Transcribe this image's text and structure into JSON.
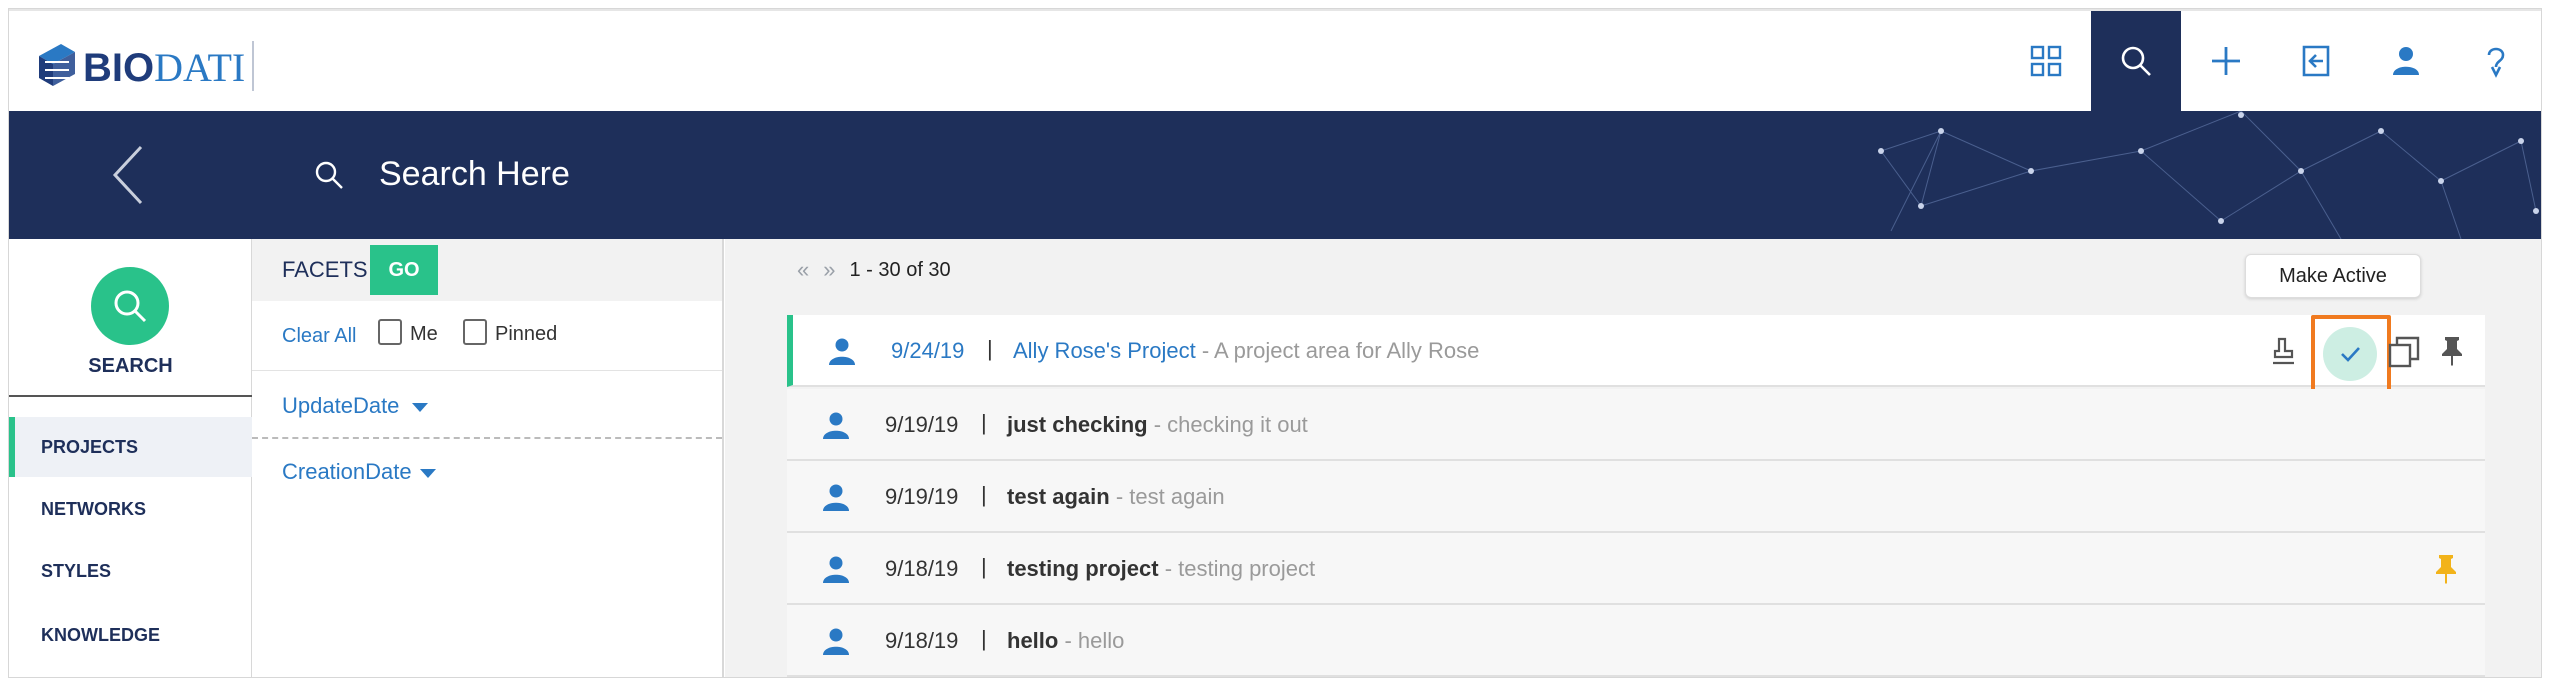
{
  "header": {
    "logo_bio": "BIO",
    "logo_dati": "DATI",
    "nav_icons": [
      "apps-grid-icon",
      "search-icon",
      "plus-icon",
      "sign-in-icon",
      "user-icon",
      "help-icon"
    ],
    "active_icon": "search-icon"
  },
  "banner": {
    "search_placeholder": "Search Here"
  },
  "sidebar": {
    "search_label": "SEARCH",
    "items": [
      {
        "label": "PROJECTS",
        "active": true
      },
      {
        "label": "NETWORKS",
        "active": false
      },
      {
        "label": "STYLES",
        "active": false
      },
      {
        "label": "KNOWLEDGE",
        "active": false
      }
    ]
  },
  "facets": {
    "title": "FACETS",
    "go_label": "GO",
    "clear_all": "Clear All",
    "me_label": "Me",
    "pinned_label": "Pinned",
    "groups": [
      "UpdateDate",
      "CreationDate"
    ]
  },
  "results": {
    "pager_prev": "«",
    "pager_next": "»",
    "range": "1 - 30 of 30",
    "tooltip": "Make Active",
    "rows": [
      {
        "date": "9/24/19",
        "name": "Ally Rose's Project",
        "desc": "- A project area for Ally Rose",
        "pinned": false
      },
      {
        "date": "9/19/19",
        "name": "just checking",
        "desc": "- checking it out",
        "pinned": false
      },
      {
        "date": "9/19/19",
        "name": "test again",
        "desc": "- test again",
        "pinned": false
      },
      {
        "date": "9/18/19",
        "name": "testing project",
        "desc": "- testing project",
        "pinned": true
      },
      {
        "date": "9/18/19",
        "name": "hello",
        "desc": "- hello",
        "pinned": false
      }
    ],
    "separator": "|"
  },
  "colors": {
    "navy": "#1e2f5a",
    "brand_blue": "#2a79c4",
    "accent_green": "#29c28a",
    "highlight_orange": "#f07a1f",
    "pin_gold": "#f2b31a"
  }
}
